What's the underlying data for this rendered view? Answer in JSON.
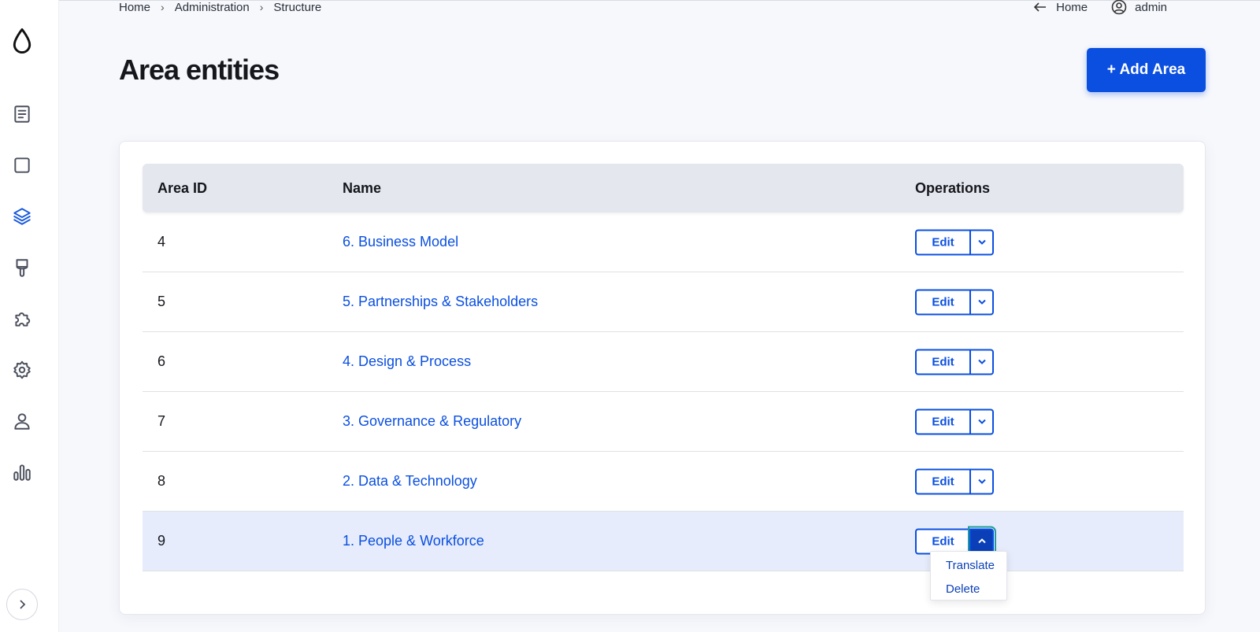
{
  "breadcrumb": [
    "Home",
    "Administration",
    "Structure"
  ],
  "toplinks": {
    "home": "Home",
    "user": "admin"
  },
  "page": {
    "title": "Area entities",
    "add_button": "+ Add Area"
  },
  "sidebar": {
    "icons": [
      "logo-drop-icon",
      "content-icon",
      "blocks-icon",
      "structure-icon",
      "appearance-icon",
      "extend-icon",
      "configuration-icon",
      "people-icon",
      "reports-icon"
    ],
    "active": "structure-icon",
    "expand": "expand-sidebar-icon"
  },
  "table": {
    "headers": {
      "id": "Area ID",
      "name": "Name",
      "ops": "Operations"
    },
    "rows": [
      {
        "id": "4",
        "name": "6. Business Model",
        "edit": "Edit"
      },
      {
        "id": "5",
        "name": "5. Partnerships & Stakeholders",
        "edit": "Edit"
      },
      {
        "id": "6",
        "name": "4. Design & Process",
        "edit": "Edit"
      },
      {
        "id": "7",
        "name": "3. Governance & Regulatory",
        "edit": "Edit"
      },
      {
        "id": "8",
        "name": "2. Data & Technology",
        "edit": "Edit"
      },
      {
        "id": "9",
        "name": "1. People & Workforce",
        "edit": "Edit"
      }
    ]
  },
  "dropdown": {
    "items": [
      "Translate",
      "Delete"
    ]
  },
  "colors": {
    "accent": "#0a4fe0",
    "highlight_row": "#e6ecfb"
  }
}
